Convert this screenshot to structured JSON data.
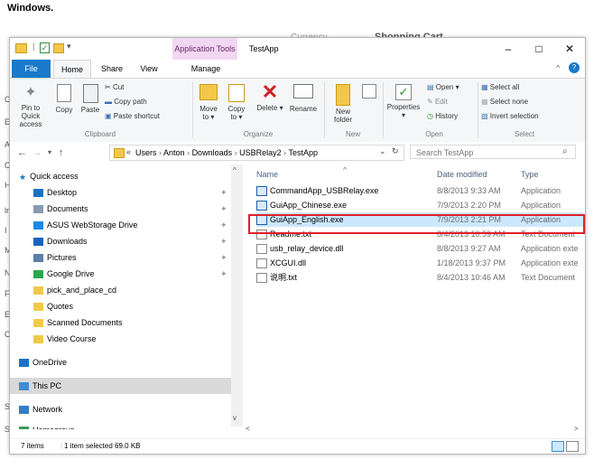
{
  "doc": {
    "heading": "Windows."
  },
  "background": {
    "left_chars": [
      "C",
      "E",
      "A",
      "C",
      "H",
      "lr",
      "I",
      "M",
      "N",
      "F",
      "E",
      "C",
      "S",
      "S"
    ],
    "currency": "Currency",
    "shopping": "Shopping Cart"
  },
  "window": {
    "title": "TestApp",
    "context_tab": "Application Tools",
    "controls": {
      "minimize": "–",
      "maximize": "□",
      "close": "✕"
    }
  },
  "ribbon_tabs": [
    {
      "label": "File"
    },
    {
      "label": "Home"
    },
    {
      "label": "Share"
    },
    {
      "label": "View"
    },
    {
      "label": "Manage"
    }
  ],
  "ribbon": {
    "pin_label": "Pin to Quick access",
    "copy_label": "Copy",
    "paste_label": "Paste",
    "cut_label": "Cut",
    "copy_path_label": "Copy path",
    "paste_shortcut_label": "Paste shortcut",
    "move_to_label": "Move to ▾",
    "copy_to_label": "Copy to ▾",
    "delete_label": "Delete ▾",
    "rename_label": "Rename",
    "new_folder_label": "New folder",
    "properties_label": "Properties ▾",
    "open_label": "Open ▾",
    "edit_label": "Edit",
    "history_label": "History",
    "select_all_label": "Select all",
    "select_none_label": "Select none",
    "invert_label": "Invert selection",
    "groups": {
      "clipboard": "Clipboard",
      "organize": "Organize",
      "new": "New",
      "open": "Open",
      "select": "Select"
    }
  },
  "address": {
    "crumbs": [
      "Users",
      "Anton",
      "Downloads",
      "USBRelay2",
      "TestApp"
    ],
    "prefix": "«",
    "search_placeholder": "Search TestApp"
  },
  "nav": [
    {
      "label": "Quick access"
    },
    {
      "label": "Desktop",
      "pinned": true
    },
    {
      "label": "Documents",
      "pinned": true
    },
    {
      "label": "ASUS WebStorage Drive",
      "pinned": true
    },
    {
      "label": "Downloads",
      "pinned": true
    },
    {
      "label": "Pictures",
      "pinned": true
    },
    {
      "label": "Google Drive",
      "pinned": true
    },
    {
      "label": "pick_and_place_cd"
    },
    {
      "label": "Quotes"
    },
    {
      "label": "Scanned Documents"
    },
    {
      "label": "Video Course"
    },
    {
      "label": "OneDrive"
    },
    {
      "label": "This PC"
    },
    {
      "label": "Network"
    },
    {
      "label": "Homegroup"
    }
  ],
  "columns": {
    "name": "Name",
    "modified": "Date modified",
    "type": "Type"
  },
  "files": [
    {
      "name": "CommandApp_USBRelay.exe",
      "date": "8/8/2013 9:33 AM",
      "type": "Application"
    },
    {
      "name": "GuiApp_Chinese.exe",
      "date": "7/9/2013 2:20 PM",
      "type": "Application"
    },
    {
      "name": "GuiApp_English.exe",
      "date": "7/9/2013 2:21 PM",
      "type": "Application",
      "selected": true
    },
    {
      "name": "Readme.txt",
      "date": "8/4/2013 10:59 AM",
      "type": "Text Document"
    },
    {
      "name": "usb_relay_device.dll",
      "date": "8/8/2013 9:27 AM",
      "type": "Application exte"
    },
    {
      "name": "XCGUI.dll",
      "date": "1/18/2013 9:37 PM",
      "type": "Application exte"
    },
    {
      "name": "说明.txt",
      "date": "8/4/2013 10:46 AM",
      "type": "Text Document"
    }
  ],
  "status": {
    "count": "7 items",
    "selection": "1 item selected  69.0 KB"
  }
}
